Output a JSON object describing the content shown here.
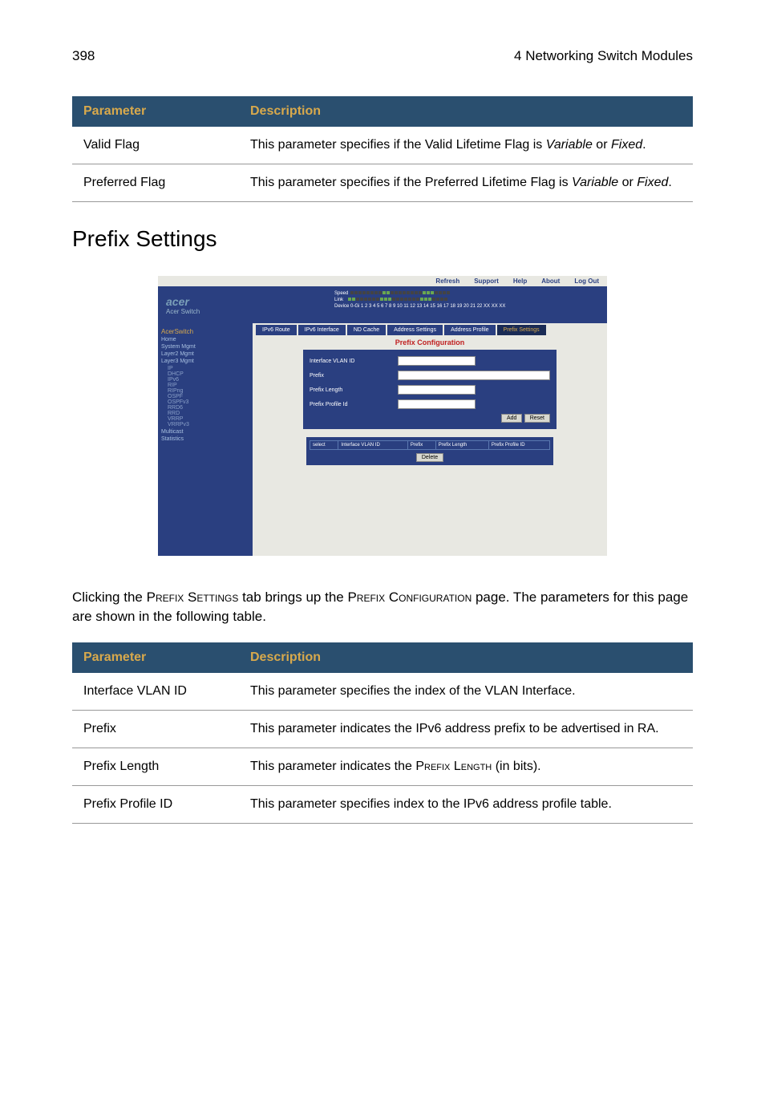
{
  "header": {
    "page_number": "398",
    "chapter": "4 Networking Switch Modules"
  },
  "table1": {
    "head": {
      "param": "Parameter",
      "desc": "Description"
    },
    "rows": [
      {
        "param": "Valid Flag",
        "desc_pre": "This parameter specifies if the Valid Lifetime Flag is ",
        "it1": "Variable",
        "mid": " or ",
        "it2": "Fixed",
        "post": "."
      },
      {
        "param": "Preferred Flag",
        "desc_pre": "This parameter specifies if the Preferred Lifetime Flag is ",
        "it1": "Variable",
        "mid": " or ",
        "it2": "Fixed",
        "post": "."
      }
    ]
  },
  "section_heading": "Prefix Settings",
  "mini": {
    "toplinks": [
      "Refresh",
      "Support",
      "Help",
      "About",
      "Log Out"
    ],
    "logo": {
      "brand": "acer",
      "sub": "Acer Switch"
    },
    "speed": {
      "speed_lbl": "Speed",
      "link_lbl": "Link",
      "device_row": "Device 0-Gi 1 2 3 4 5 6 7 8 9 10 11 12 13 14 15 16 17 18 19 20 21 22 XX XX XX"
    },
    "sidebar": {
      "title": "AcerSwitch",
      "home": "Home",
      "groups": [
        "System Mgmt",
        "Layer2 Mgmt",
        "Layer3 Mgmt"
      ],
      "l3children": [
        "IP",
        "DHCP",
        "IPv6",
        "RIP",
        "RIPng",
        "OSPF",
        "OSPFv3",
        "RRD6",
        "RRD",
        "VRRP",
        "VRRPv3"
      ],
      "groups2": [
        "Multicast",
        "Statistics"
      ]
    },
    "tabs": [
      "IPv6 Route",
      "IPv6 Interface",
      "ND Cache",
      "Address Settings",
      "Address Profile",
      "Prefix Settings"
    ],
    "content_title": "Prefix Configuration",
    "form": {
      "f1": "Interface VLAN ID",
      "f2": "Prefix",
      "f3": "Prefix Length",
      "f4": "Prefix Profile Id",
      "btn_add": "Add",
      "btn_reset": "Reset"
    },
    "result_table": {
      "cols": [
        "select",
        "Interface VLAN ID",
        "Prefix",
        "Prefix Length",
        "Prefix Profile ID"
      ],
      "btn_delete": "Delete"
    }
  },
  "body_text": {
    "p1a": "Clicking the ",
    "p1b": "Prefix Settings",
    "p1c": " tab brings up the ",
    "p1d": "Prefix Configuration",
    "p1e": " page. The parameters for this page are shown in the following table."
  },
  "table2": {
    "head": {
      "param": "Parameter",
      "desc": "Description"
    },
    "rows": [
      {
        "param": "Interface VLAN ID",
        "desc": "This parameter specifies the index of the VLAN Interface."
      },
      {
        "param": "Prefix",
        "desc": "This parameter indicates the IPv6 address prefix to be advertised in RA."
      },
      {
        "param": "Prefix Length",
        "desc_pre": "This parameter indicates the ",
        "sc": "Prefix Length",
        "desc_post": " (in bits)."
      },
      {
        "param": "Prefix Profile ID",
        "desc": "This parameter specifies index to the IPv6 address profile table."
      }
    ]
  }
}
